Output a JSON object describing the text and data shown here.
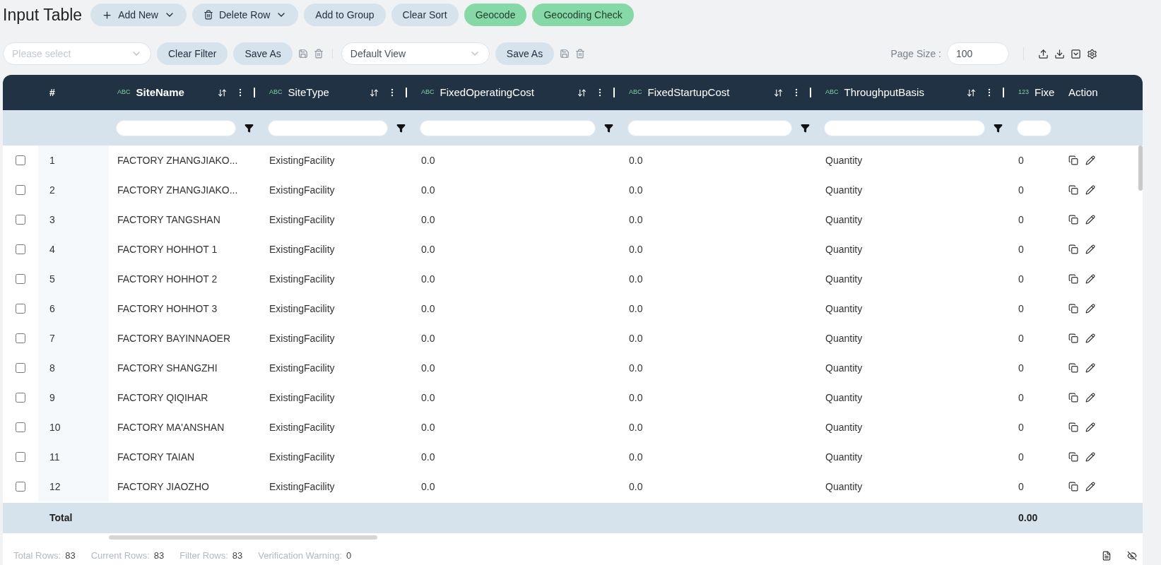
{
  "title": "Input Table",
  "toolbar": [
    {
      "label": "Add New",
      "kind": "menu"
    },
    {
      "label": "Delete Row",
      "kind": "menu"
    },
    {
      "label": "Add to Group",
      "kind": "plain"
    },
    {
      "label": "Clear Sort",
      "kind": "plain"
    },
    {
      "label": "Geocode",
      "kind": "accent"
    },
    {
      "label": "Geocoding Check",
      "kind": "accent"
    }
  ],
  "filter_bar": {
    "filter_select": {
      "placeholder": "Please select"
    },
    "clear_filter": "Clear Filter",
    "save_filter": "Save As",
    "view_select": {
      "value": "Default View"
    },
    "save_view": "Save As",
    "page_size": {
      "label": "Page Size :",
      "value": "100"
    }
  },
  "table": {
    "index_heading": "#",
    "action_heading": "Action",
    "columns": [
      {
        "type": "ABC",
        "label": "SiteName",
        "active": true
      },
      {
        "type": "ABC",
        "label": "SiteType",
        "active": false
      },
      {
        "type": "ABC",
        "label": "FixedOperatingCost",
        "active": false
      },
      {
        "type": "ABC",
        "label": "FixedStartupCost",
        "active": false
      },
      {
        "type": "ABC",
        "label": "ThroughputBasis",
        "active": false
      },
      {
        "type": "123",
        "label": "Fixe",
        "active": false
      }
    ],
    "rows": [
      {
        "index": "1",
        "checked": false,
        "cells": [
          "FACTORY ZHANGJIAKO...",
          "ExistingFacility",
          "0.0",
          "0.0",
          "Quantity",
          "0"
        ]
      },
      {
        "index": "2",
        "checked": false,
        "cells": [
          "FACTORY ZHANGJIAKO...",
          "ExistingFacility",
          "0.0",
          "0.0",
          "Quantity",
          "0"
        ]
      },
      {
        "index": "3",
        "checked": false,
        "cells": [
          "FACTORY TANGSHAN",
          "ExistingFacility",
          "0.0",
          "0.0",
          "Quantity",
          "0"
        ]
      },
      {
        "index": "4",
        "checked": false,
        "cells": [
          "FACTORY HOHHOT 1",
          "ExistingFacility",
          "0.0",
          "0.0",
          "Quantity",
          "0"
        ]
      },
      {
        "index": "5",
        "checked": false,
        "cells": [
          "FACTORY HOHHOT 2",
          "ExistingFacility",
          "0.0",
          "0.0",
          "Quantity",
          "0"
        ]
      },
      {
        "index": "6",
        "checked": false,
        "cells": [
          "FACTORY HOHHOT 3",
          "ExistingFacility",
          "0.0",
          "0.0",
          "Quantity",
          "0"
        ]
      },
      {
        "index": "7",
        "checked": false,
        "cells": [
          "FACTORY BAYINNAOER",
          "ExistingFacility",
          "0.0",
          "0.0",
          "Quantity",
          "0"
        ]
      },
      {
        "index": "8",
        "checked": false,
        "cells": [
          "FACTORY SHANGZHI",
          "ExistingFacility",
          "0.0",
          "0.0",
          "Quantity",
          "0"
        ]
      },
      {
        "index": "9",
        "checked": false,
        "cells": [
          "FACTORY QIQIHAR",
          "ExistingFacility",
          "0.0",
          "0.0",
          "Quantity",
          "0"
        ]
      },
      {
        "index": "10",
        "checked": false,
        "cells": [
          "FACTORY MA'ANSHAN",
          "ExistingFacility",
          "0.0",
          "0.0",
          "Quantity",
          "0"
        ]
      },
      {
        "index": "11",
        "checked": false,
        "cells": [
          "FACTORY TAIAN",
          "ExistingFacility",
          "0.0",
          "0.0",
          "Quantity",
          "0"
        ]
      },
      {
        "index": "12",
        "checked": false,
        "cells": [
          "FACTORY JIAOZHO",
          "ExistingFacility",
          "0.0",
          "0.0",
          "Quantity",
          "0"
        ]
      }
    ],
    "total": {
      "label": "Total",
      "value": "0.00"
    }
  },
  "status_bar": [
    {
      "label": "Total Rows:",
      "value": "83"
    },
    {
      "label": "Current Rows:",
      "value": "83"
    },
    {
      "label": "Filter Rows:",
      "value": "83"
    },
    {
      "label": "Verification Warning:",
      "value": "0"
    }
  ]
}
